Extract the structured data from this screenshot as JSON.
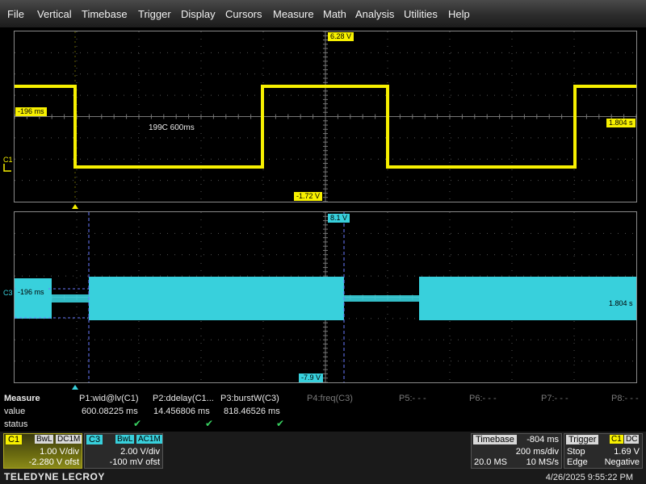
{
  "menu": [
    "File",
    "Vertical",
    "Timebase",
    "Trigger",
    "Display",
    "Cursors",
    "Measure",
    "Math",
    "Analysis",
    "Utilities",
    "Help"
  ],
  "upper_grid": {
    "channel_label": "C1",
    "top_tag": "6.28 V",
    "bottom_tag": "-1.72 V",
    "left_tag": "-196 ms",
    "right_tag": "1.804 s",
    "annotation": "199C 600ms",
    "trace_color": "#f7f000"
  },
  "lower_grid": {
    "channel_label": "C3",
    "top_tag": "8.1 V",
    "bottom_tag": "-7.9 V",
    "left_tag": "-196 ms",
    "right_tag": "1.804 s",
    "trace_color": "#38d0dc"
  },
  "measure": {
    "title": "Measure",
    "row_labels": [
      "value",
      "status"
    ],
    "params": [
      {
        "name": "P1:wid@lv(C1)",
        "value": "600.08225 ms",
        "status": "ok",
        "active": true
      },
      {
        "name": "P2:ddelay(C1...",
        "value": "14.456806 ms",
        "status": "ok",
        "active": true
      },
      {
        "name": "P3:burstW(C3)",
        "value": "818.46526 ms",
        "status": "ok",
        "active": true
      },
      {
        "name": "P4:freq(C3)",
        "value": "",
        "status": "",
        "active": false
      },
      {
        "name": "P5:- - -",
        "value": "",
        "status": "",
        "active": false
      },
      {
        "name": "P6:- - -",
        "value": "",
        "status": "",
        "active": false
      },
      {
        "name": "P7:- - -",
        "value": "",
        "status": "",
        "active": false
      },
      {
        "name": "P8:- - -",
        "value": "",
        "status": "",
        "active": false
      }
    ],
    "check_glyph": "✔"
  },
  "c1_box": {
    "label": "C1",
    "bwl": "BwL",
    "coupling": "DC1M",
    "vdiv": "1.00 V/div",
    "offset": "-2.280 V ofst"
  },
  "c3_box": {
    "label": "C3",
    "bwl": "BwL",
    "coupling": "AC1M",
    "vdiv": "2.00 V/div",
    "offset": "-100 mV ofst"
  },
  "timebase": {
    "title": "Timebase",
    "delay": "-804 ms",
    "tdiv": "200 ms/div",
    "samples": "20.0 MS",
    "rate": "10 MS/s"
  },
  "trigger": {
    "title": "Trigger",
    "source": "C1",
    "coupling": "DC",
    "mode": "Stop",
    "level": "1.69 V",
    "type": "Edge",
    "slope": "Negative"
  },
  "brand": "TELEDYNE LECROY",
  "datetime": "4/26/2025 9:55:22 PM",
  "colors": {
    "ch1": "#f7f000",
    "ch3": "#38d0dc",
    "ok": "#38d060"
  }
}
